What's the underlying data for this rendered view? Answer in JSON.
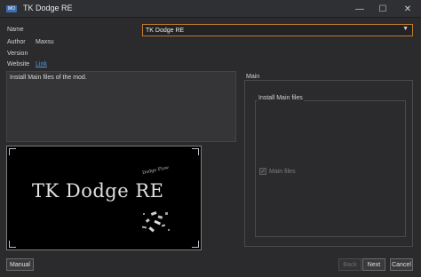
{
  "window": {
    "icon_text": "MO",
    "title": "TK Dodge RE",
    "minimize_glyph": "—",
    "maximize_glyph": "☐",
    "close_glyph": "✕"
  },
  "info": {
    "name_label": "Name",
    "name_value": "TK Dodge RE",
    "author_label": "Author",
    "author_value": "Maxsu",
    "version_label": "Version",
    "version_value": "",
    "website_label": "Website",
    "website_link": "Link"
  },
  "description": "Install Main files of the mod.",
  "image": {
    "logo_text": "TK Dodge RE",
    "logo_subtext": "Dodge Flow"
  },
  "page": {
    "group_title": "Main",
    "subgroup_title": "Install Main files",
    "options": [
      {
        "label": "Main files",
        "checked": true,
        "enabled": false
      }
    ]
  },
  "buttons": {
    "manual": "Manual",
    "back": "Back",
    "next": "Next",
    "cancel": "Cancel"
  },
  "colors": {
    "accent_border": "#c27a2c",
    "link": "#4a9de0",
    "background": "#2b2b2d"
  }
}
